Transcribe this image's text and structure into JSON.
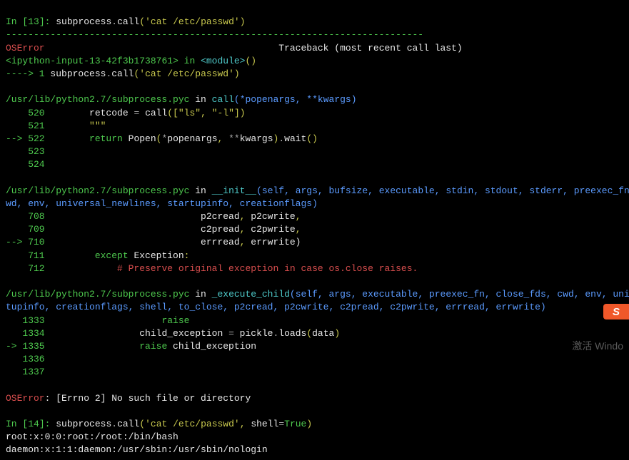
{
  "cells": {
    "in13": {
      "prompt_prefix": "In [",
      "prompt_num": "13",
      "prompt_suffix": "]: ",
      "code_mod": "subprocess",
      "code_dot": ".",
      "code_fn": "call",
      "code_paren_open": "(",
      "code_arg": "'cat /etc/passwd'",
      "code_paren_close": ")"
    },
    "dashline": "---------------------------------------------------------------------------",
    "err_name": "OSError",
    "tb_header_pad": "                                          ",
    "tb_header": "Traceback (most recent call last)",
    "tb_loc1_pre": "<",
    "tb_loc1_file": "ipython-input-13-42f3b1738761",
    "tb_loc1_mid": "> in ",
    "tb_loc1_mod": "<module>",
    "tb_loc1_after": "()",
    "arrow1": "----> 1 ",
    "line1_mod": "subprocess",
    "line1_dot": ".",
    "line1_fn": "call",
    "line1_open": "(",
    "line1_arg": "'cat /etc/passwd'",
    "line1_close": ")",
    "file_subproc": "/usr/lib/python2.7/subprocess.pyc",
    "in_txt": " in ",
    "call_fn": "call",
    "call_sig": "(*popenargs, **kwargs)",
    "l520_no": "    520     ",
    "l520_code_a": "   retcode ",
    "l520_eq": "= ",
    "l520_code_b": "call",
    "l520_open": "([",
    "l520_s1": "\"ls\"",
    "l520_c": ", ",
    "l520_s2": "\"-l\"",
    "l520_close": "])",
    "l521_no": "    521     ",
    "l521_code": "   \"\"\"",
    "l522_arrow": "--> 522     ",
    "l522_ret": "   return ",
    "l522_popen": "Popen",
    "l522_open": "(",
    "l522_star": "*",
    "l522_a1": "popenargs",
    "l522_c": ", ",
    "l522_dstar": "**",
    "l522_a2": "kwargs",
    "l522_close": ")",
    "l522_dot": ".",
    "l522_wait": "wait",
    "l522_paren": "()",
    "l523_no": "    523",
    "l524_no": "    524",
    "init_fn": "__init__",
    "init_sig_a": "(self, args, bufsize, executable, stdin, stdout, stderr, preexec_fn, cl",
    "init_sig_b": "wd, env, universal_newlines, startupinfo, creationflags)",
    "l708_no": "    708                            ",
    "l708_a": "p2cread",
    "l708_c": ", ",
    "l708_b": "p2cwrite",
    "l708_end": ",",
    "l709_no": "    709                            ",
    "l709_a": "c2pread",
    "l709_b": "c2pwrite",
    "l710_arrow": "--> 710                            ",
    "l710_a": "errread",
    "l710_b": "errwrite)",
    "l711_no": "    711         ",
    "l711_kw": "except ",
    "l711_exc": "Exception",
    "l711_colon": ":",
    "l712_no": "    712             ",
    "l712_comment": "# Preserve original exception in case os.close raises.",
    "exec_fn": "_execute_child",
    "exec_sig_a": "(self, args, executable, preexec_fn, close_fds, cwd, env, univers",
    "exec_sig_b": "tupinfo, creationflags, shell, to_close, p2cread, p2cwrite, c2pread, c2pwrite, errread, errwrite)",
    "l1333_no": "   1333                     ",
    "l1333_kw": "raise",
    "l1334_no": "   1334                 ",
    "l1334_a": "child_exception ",
    "l1334_eq": "= ",
    "l1334_b": "pickle",
    "l1334_dot": ".",
    "l1334_c": "loads",
    "l1334_open": "(",
    "l1334_d": "data",
    "l1334_close": ")",
    "l1335_arrow": "-> 1335                 ",
    "l1335_kw": "raise ",
    "l1335_a": "child_exception",
    "l1336_no": "   1336",
    "l1337_no": "   1337",
    "err_final": "OSError",
    "err_msg": ": [Errno 2] No such file or directory",
    "in14": {
      "prompt_num": "14",
      "code_mod": "subprocess",
      "code_fn": "call",
      "code_arg1": "'cat /etc/passwd'",
      "code_c": ", ",
      "code_kw": "shell",
      "code_eq": "=",
      "code_val": "True",
      "code_close": ")"
    },
    "out_line1": "root:x:0:0:root:/root:/bin/bash",
    "out_line2": "daemon:x:1:1:daemon:/usr/sbin:/usr/sbin/nologin"
  },
  "watermark": {
    "line1": "激活 Windo"
  },
  "badge": "S"
}
